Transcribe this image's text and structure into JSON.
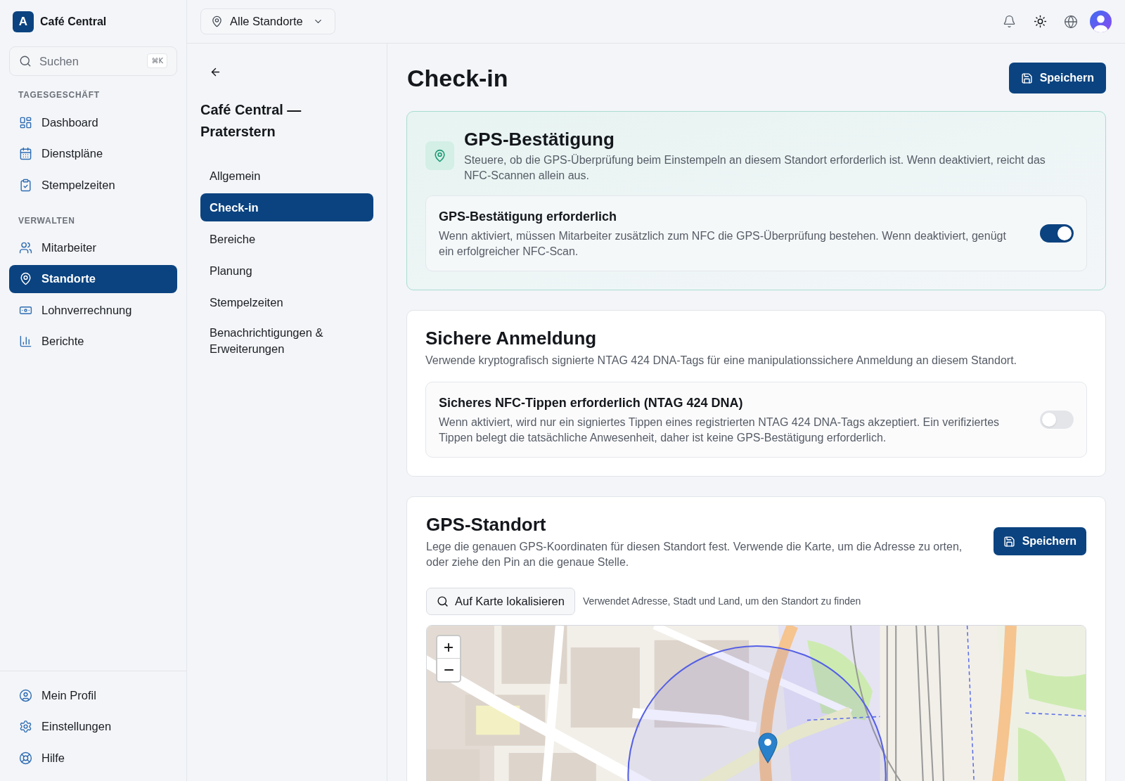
{
  "app": {
    "logo": "A",
    "name": "Café Central"
  },
  "sidebar": {
    "search": {
      "placeholder": "Suchen",
      "shortcut": "⌘K"
    },
    "sections": [
      {
        "label": "TAGESGESCHÄFT",
        "items": [
          {
            "label": "Dashboard",
            "selected": false
          },
          {
            "label": "Dienstpläne",
            "selected": false
          },
          {
            "label": "Stempelzeiten",
            "selected": false
          }
        ]
      },
      {
        "label": "VERWALTEN",
        "items": [
          {
            "label": "Mitarbeiter",
            "selected": false
          },
          {
            "label": "Standorte",
            "selected": true
          },
          {
            "label": "Lohnverrechnung",
            "selected": false
          },
          {
            "label": "Berichte",
            "selected": false
          }
        ]
      }
    ],
    "footer_items": [
      "Mein Profil",
      "Einstellungen",
      "Hilfe"
    ]
  },
  "topbar": {
    "location_select": {
      "value": "Alle Standorte"
    }
  },
  "settings_nav": {
    "title": "Café Central — Praterstern",
    "items": [
      {
        "label": "Allgemein",
        "selected": false
      },
      {
        "label": "Check-in",
        "selected": true
      },
      {
        "label": "Bereiche",
        "selected": false
      },
      {
        "label": "Planung",
        "selected": false
      },
      {
        "label": "Stempelzeiten",
        "selected": false
      },
      {
        "label": "Benachrichtigungen & Erweiterungen",
        "selected": false
      }
    ]
  },
  "page": {
    "title": "Check-in",
    "save_button": "Speichern"
  },
  "gps_confirmation": {
    "title": "GPS-Bestätigung",
    "description": "Steuere, ob die GPS-Überprüfung beim Einstempeln an diesem Standort erforderlich ist. Wenn deaktiviert, reicht das NFC-Scannen allein aus.",
    "toggle": {
      "label": "GPS-Bestätigung erforderlich",
      "description": "Wenn aktiviert, müssen Mitarbeiter zusätzlich zum NFC die GPS-Überprüfung bestehen. Wenn deaktiviert, genügt ein erfolgreicher NFC-Scan.",
      "on": true
    }
  },
  "secure_login": {
    "title": "Sichere Anmeldung",
    "description": "Verwende kryptografisch signierte NTAG 424 DNA-Tags für eine manipulationssichere Anmeldung an diesem Standort.",
    "toggle": {
      "label": "Sicheres NFC-Tippen erforderlich (NTAG 424 DNA)",
      "description": "Wenn aktiviert, wird nur ein signiertes Tippen eines registrierten NTAG 424 DNA-Tags akzeptiert. Ein verifiziertes Tippen belegt die tatsächliche Anwesenheit, daher ist keine GPS-Bestätigung erforderlich.",
      "on": false
    }
  },
  "gps_location": {
    "title": "GPS-Standort",
    "description": "Lege die genauen GPS-Koordinaten für diesen Standort fest. Verwende die Karte, um die Adresse zu orten, oder ziehe den Pin an die genaue Stelle.",
    "save_button": "Speichern",
    "locate_button": "Auf Karte lokalisieren",
    "locate_hint": "Verwendet Adresse, Stadt und Land, um den Standort zu finden"
  }
}
